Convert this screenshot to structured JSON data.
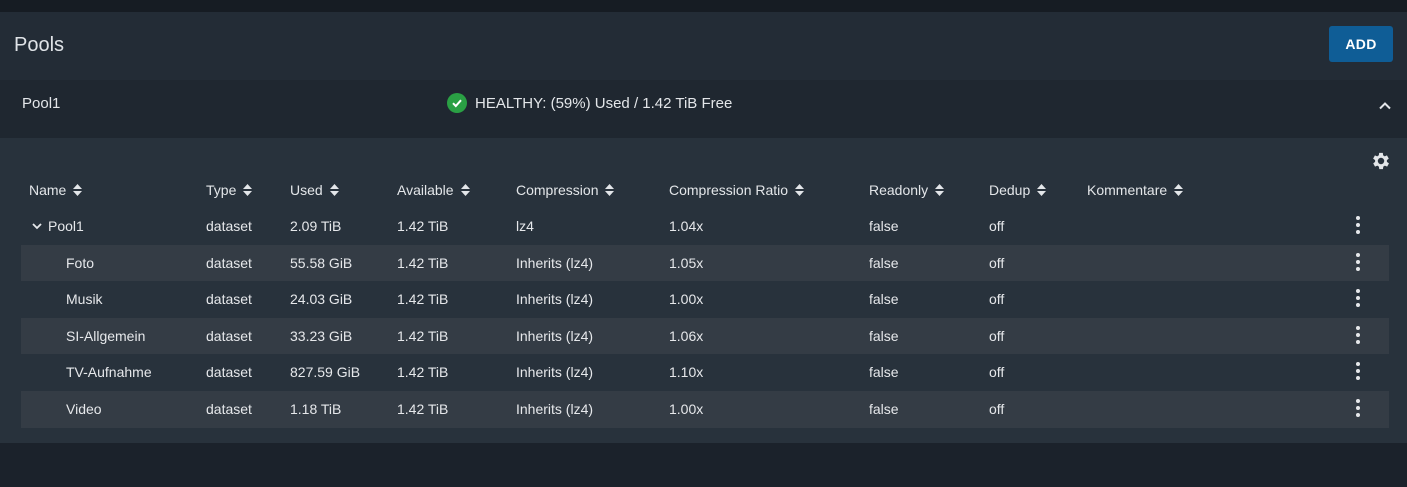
{
  "page": {
    "title": "Pools",
    "add_label": "ADD"
  },
  "pool": {
    "name": "Pool1",
    "status": "HEALTHY: (59%) Used / 1.42 TiB Free"
  },
  "table": {
    "columns": [
      "Name",
      "Type",
      "Used",
      "Available",
      "Compression",
      "Compression Ratio",
      "Readonly",
      "Dedup",
      "Kommentare"
    ],
    "rows": [
      {
        "name": "Pool1",
        "type": "dataset",
        "used": "2.09 TiB",
        "available": "1.42 TiB",
        "compression": "lz4",
        "ratio": "1.04x",
        "readonly": "false",
        "dedup": "off",
        "comment": ""
      },
      {
        "name": "Foto",
        "type": "dataset",
        "used": "55.58 GiB",
        "available": "1.42 TiB",
        "compression": "Inherits (lz4)",
        "ratio": "1.05x",
        "readonly": "false",
        "dedup": "off",
        "comment": ""
      },
      {
        "name": "Musik",
        "type": "dataset",
        "used": "24.03 GiB",
        "available": "1.42 TiB",
        "compression": "Inherits (lz4)",
        "ratio": "1.00x",
        "readonly": "false",
        "dedup": "off",
        "comment": ""
      },
      {
        "name": "SI-Allgemein",
        "type": "dataset",
        "used": "33.23 GiB",
        "available": "1.42 TiB",
        "compression": "Inherits (lz4)",
        "ratio": "1.06x",
        "readonly": "false",
        "dedup": "off",
        "comment": ""
      },
      {
        "name": "TV-Aufnahme",
        "type": "dataset",
        "used": "827.59 GiB",
        "available": "1.42 TiB",
        "compression": "Inherits (lz4)",
        "ratio": "1.10x",
        "readonly": "false",
        "dedup": "off",
        "comment": ""
      },
      {
        "name": "Video",
        "type": "dataset",
        "used": "1.18 TiB",
        "available": "1.42 TiB",
        "compression": "Inherits (lz4)",
        "ratio": "1.00x",
        "readonly": "false",
        "dedup": "off",
        "comment": ""
      }
    ]
  },
  "colors": {
    "accent": "#0f5d96",
    "healthy": "#2aa044",
    "panel": "#232c36",
    "row_alt": "#343c45"
  },
  "icons": {
    "status": "check-circle-icon",
    "collapse": "chevron-up-icon",
    "settings": "gear-icon",
    "sort": "sort-icon",
    "expand": "chevron-down-icon",
    "row_menu": "more-vert-icon"
  }
}
